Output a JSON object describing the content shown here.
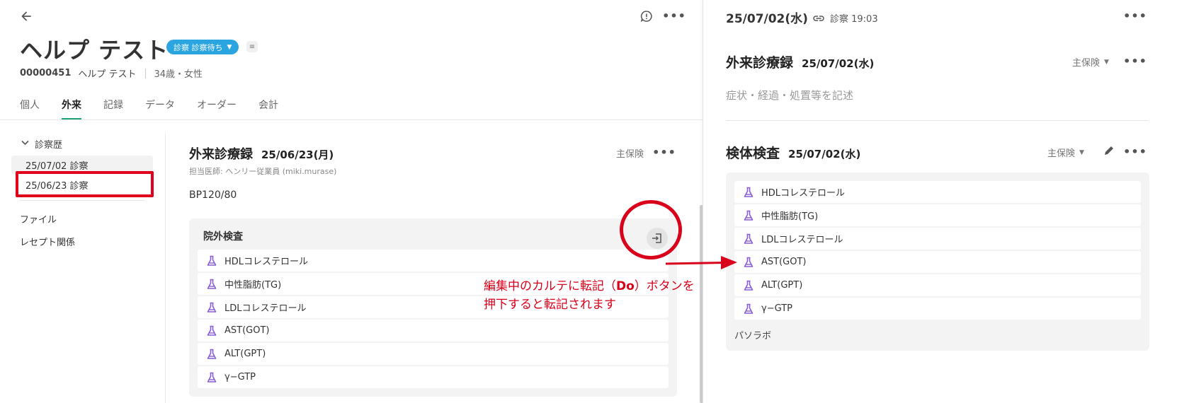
{
  "header": {
    "patient_name": "ヘルプ テスト",
    "status_badge": "診察 診察待ち",
    "patient_id": "00000451",
    "patient_name_small": "ヘルプ テスト",
    "age_gender": "34歳・女性"
  },
  "tabs": [
    {
      "label": "個人"
    },
    {
      "label": "外来"
    },
    {
      "label": "記録"
    },
    {
      "label": "データ"
    },
    {
      "label": "オーダー"
    },
    {
      "label": "会計"
    }
  ],
  "sidebar": {
    "heading": "診察歴",
    "visits": [
      {
        "label": "25/07/02 診察"
      },
      {
        "label": "25/06/23 診察"
      }
    ],
    "links": [
      {
        "label": "ファイル"
      },
      {
        "label": "レセプト関係"
      }
    ]
  },
  "record": {
    "title": "外来診療録",
    "date": "25/06/23(月)",
    "insurance": "主保険",
    "doctor": "担当医師: ヘンリー従業員 (miki.murase)",
    "note": "BP120/80",
    "exam_title": "院外検査",
    "exam_items": [
      "HDLコレステロール",
      "中性脂肪(TG)",
      "LDLコレステロール",
      "AST(GOT)",
      "ALT(GPT)",
      "γ−GTP"
    ]
  },
  "right": {
    "date": "25/07/02(水)",
    "visit_link": "診察 19:03",
    "record_title": "外来診療録",
    "record_date": "25/07/02(水)",
    "insurance": "主保険",
    "placeholder": "症状・経過・処置等を記述",
    "lab_title": "検体検査",
    "lab_date": "25/07/02(水)",
    "lab_insurance": "主保険",
    "lab_items": [
      "HDLコレステロール",
      "中性脂肪(TG)",
      "LDLコレステロール",
      "AST(GOT)",
      "ALT(GPT)",
      "γ−GTP"
    ],
    "lab_name": "パソラボ"
  },
  "annotation": {
    "line1_pre": "編集中のカルテに転記（",
    "line1_bold": "Do",
    "line1_post": "）ボタンを",
    "line2": "押下すると転記されます"
  },
  "colors": {
    "badge": "#2ba5e0",
    "active_tab_underline": "#1aa37a",
    "annotation_red": "#d8001a",
    "flask_purple": "#8a5cd6"
  }
}
